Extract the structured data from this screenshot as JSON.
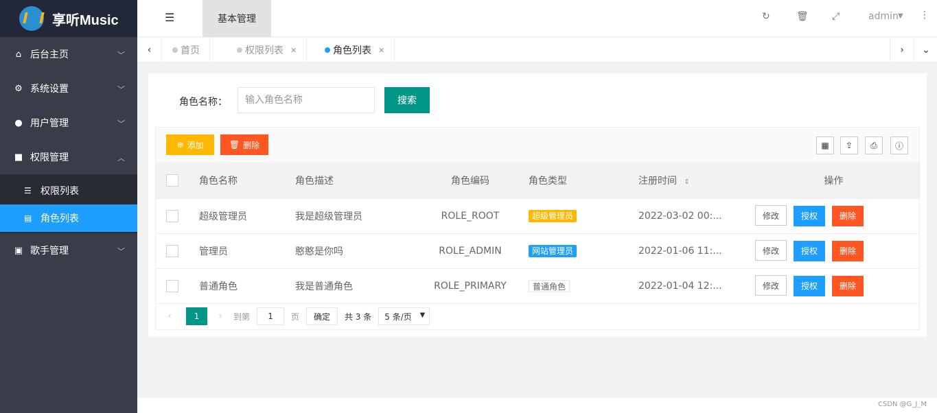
{
  "app": {
    "title": "享听Music"
  },
  "sidebar": {
    "items": [
      {
        "label": "后台主页",
        "icon": "home-icon"
      },
      {
        "label": "系统设置",
        "icon": "gears-icon"
      },
      {
        "label": "用户管理",
        "icon": "user-icon"
      },
      {
        "label": "权限管理",
        "icon": "lock-icon",
        "expanded": true
      },
      {
        "label": "歌手管理",
        "icon": "contact-icon"
      }
    ],
    "sub_items": [
      {
        "label": "权限列表",
        "icon": "list-icon"
      },
      {
        "label": "角色列表",
        "icon": "card-icon",
        "active": true
      }
    ]
  },
  "header": {
    "top_tab": "基本管理",
    "user": "admin"
  },
  "tabs": [
    {
      "label": "首页"
    },
    {
      "label": "权限列表"
    },
    {
      "label": "角色列表",
      "active": true
    }
  ],
  "search": {
    "label": "角色名称：",
    "placeholder": "输入角色名称",
    "button": "搜索"
  },
  "toolbar": {
    "add_label": "添加",
    "delete_label": "删除"
  },
  "table": {
    "columns": [
      "角色名称",
      "角色描述",
      "角色编码",
      "角色类型",
      "注册时间",
      "操作"
    ],
    "rows": [
      {
        "name": "超级管理员",
        "desc": "我是超级管理员",
        "code": "ROLE_ROOT",
        "type": "超级管理员",
        "time": "2022-03-02 00:..."
      },
      {
        "name": "管理员",
        "desc": "憨憨是你吗",
        "code": "ROLE_ADMIN",
        "type": "网站管理员",
        "time": "2022-01-06 11:..."
      },
      {
        "name": "普通角色",
        "desc": "我是普通角色",
        "code": "ROLE_PRIMARY",
        "type": "普通角色",
        "time": "2022-01-04 12:..."
      }
    ],
    "actions": {
      "edit": "修改",
      "auth": "授权",
      "delete": "删除"
    }
  },
  "pager": {
    "current": "1",
    "goto_label": "到第",
    "goto_value": "1",
    "page_unit": "页",
    "confirm": "确定",
    "total": "共 3 条",
    "page_size": "5 条/页"
  },
  "footer": {
    "watermark": "CSDN @G_J_M"
  },
  "colors": {
    "sidebar_bg": "#393d49",
    "active_blue": "#1e9fff",
    "primary_green": "#009688",
    "warn_yellow": "#ffb800",
    "danger_orange": "#ff5722"
  }
}
